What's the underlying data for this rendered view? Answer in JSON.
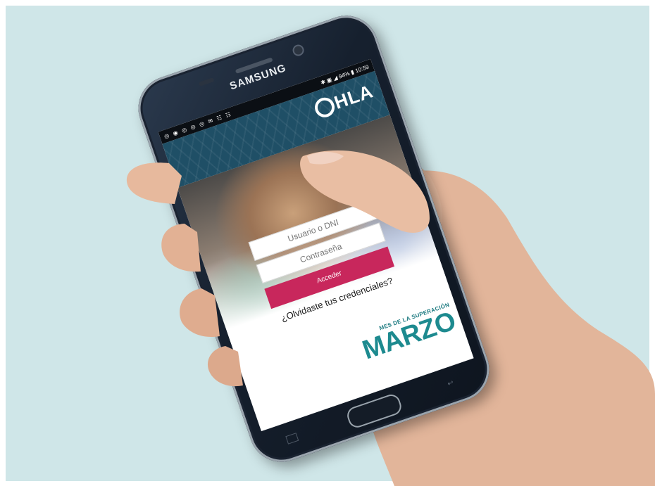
{
  "phone": {
    "brand": "SAMSUNG"
  },
  "status_bar": {
    "left_icons": "◎ ◉ ◎ ◎ ◎ ✉ ☷ ☷",
    "right_info": "✱ ▣ ◢ 94% ▮ 10:59"
  },
  "app": {
    "logo_text": "HLA",
    "login": {
      "username_placeholder": "Usuario o DNI",
      "password_placeholder": "Contraseña",
      "submit_label": "Acceder",
      "forgot_link": "¿Olvidaste tus credenciales?"
    },
    "campaign": {
      "subtitle": "MES DE LA SUPERACIÓN",
      "title": "MARZO"
    }
  },
  "colors": {
    "background": "#cfe6e8",
    "header": "#1f4f66",
    "accent_button": "#c8275c",
    "campaign_teal": "#1d8a8f"
  },
  "icons": [
    "camera-icon",
    "home-button",
    "back-key-icon",
    "recent-apps-icon"
  ]
}
